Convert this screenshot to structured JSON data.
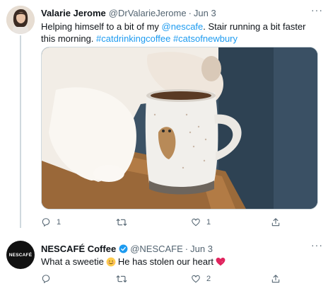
{
  "tweet1": {
    "author_name": "Valarie Jerome",
    "handle": "@DrValarieJerome",
    "separator": "·",
    "date": "Jun 3",
    "more": "···",
    "text_before_mention": "Helping himself to a bit of my ",
    "mention": "@nescafe",
    "text_after_mention": ". Stair running a bit faster this morning. ",
    "hashtag1": "#catdrinkingcoffee",
    "hashtag2": "#catsofnewbury",
    "reply_count": "1",
    "like_count": "1"
  },
  "tweet2": {
    "author_name": "NESCAFÉ Coffee",
    "handle": "@NESCAFE",
    "separator": "·",
    "date": "Jun 3",
    "more": "···",
    "avatar_text": "NESCAFÉ",
    "text_part1": "What a sweetie",
    "text_part2": " He has stolen our heart",
    "like_count": "2"
  },
  "colors": {
    "link": "#1d9bf0",
    "muted": "#536471",
    "verified": "#1d9bf0",
    "heart": "#e0245e"
  },
  "icons": [
    "reply-icon",
    "retweet-icon",
    "like-icon",
    "share-icon",
    "verified-badge-icon",
    "smiling-face-emoji",
    "heart-emoji"
  ]
}
